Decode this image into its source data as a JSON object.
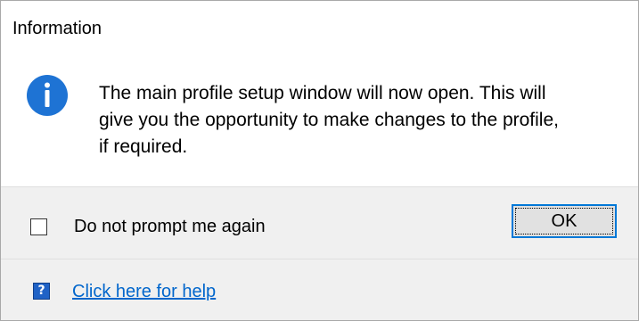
{
  "dialog": {
    "title": "Information",
    "icon": "info-icon",
    "message_lines": [
      "The main profile setup window will now open. This will",
      "give you the opportunity to make changes to the profile,",
      "if required."
    ]
  },
  "buttons": {
    "checkbox_label": "Do not prompt me again",
    "checkbox_checked": false,
    "ok_label": "OK"
  },
  "footer": {
    "help_icon": "help-icon",
    "help_icon_glyph": "?",
    "help_link_text": "Click here for help"
  },
  "colors": {
    "accent": "#0078d7",
    "info_icon": "#1e73d4",
    "link": "#0066cc",
    "panel_bg": "#f0f0f0"
  }
}
